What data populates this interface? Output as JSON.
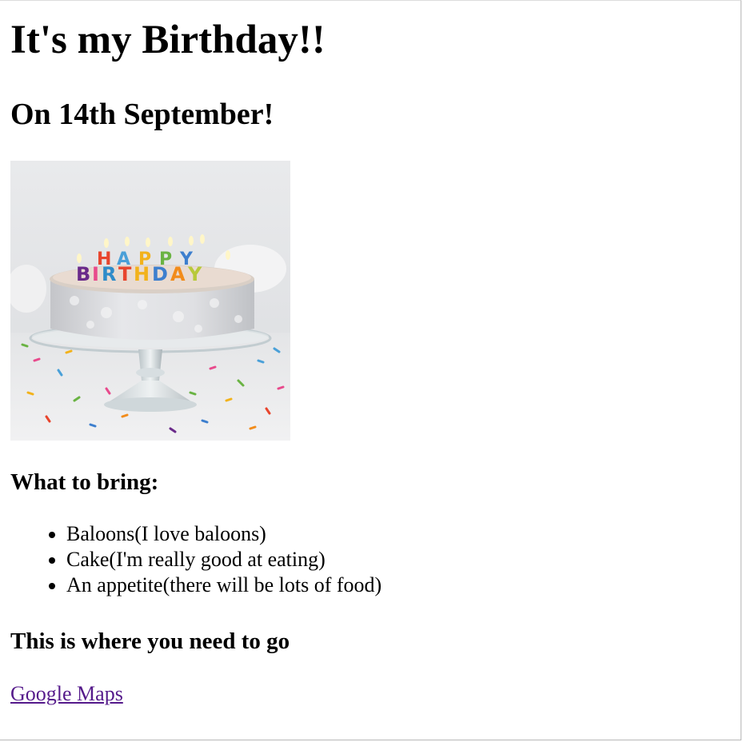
{
  "heading": "It's my Birthday!!",
  "date_heading": "On 14th September!",
  "cake_image": {
    "icon": "birthday-cake-photo",
    "candle_letters_top": "HAPPY",
    "candle_letters_bottom": "BIRTHDAY"
  },
  "bring_heading": "What to bring:",
  "bring_items": [
    "Baloons(I love baloons)",
    "Cake(I'm really good at eating)",
    "An appetite(there will be lots of food)"
  ],
  "where_heading": "This is where you need to go",
  "maps_link": "Google Maps",
  "colors": {
    "link_visited": "#551a8b",
    "text": "#000000",
    "background": "#ffffff"
  }
}
